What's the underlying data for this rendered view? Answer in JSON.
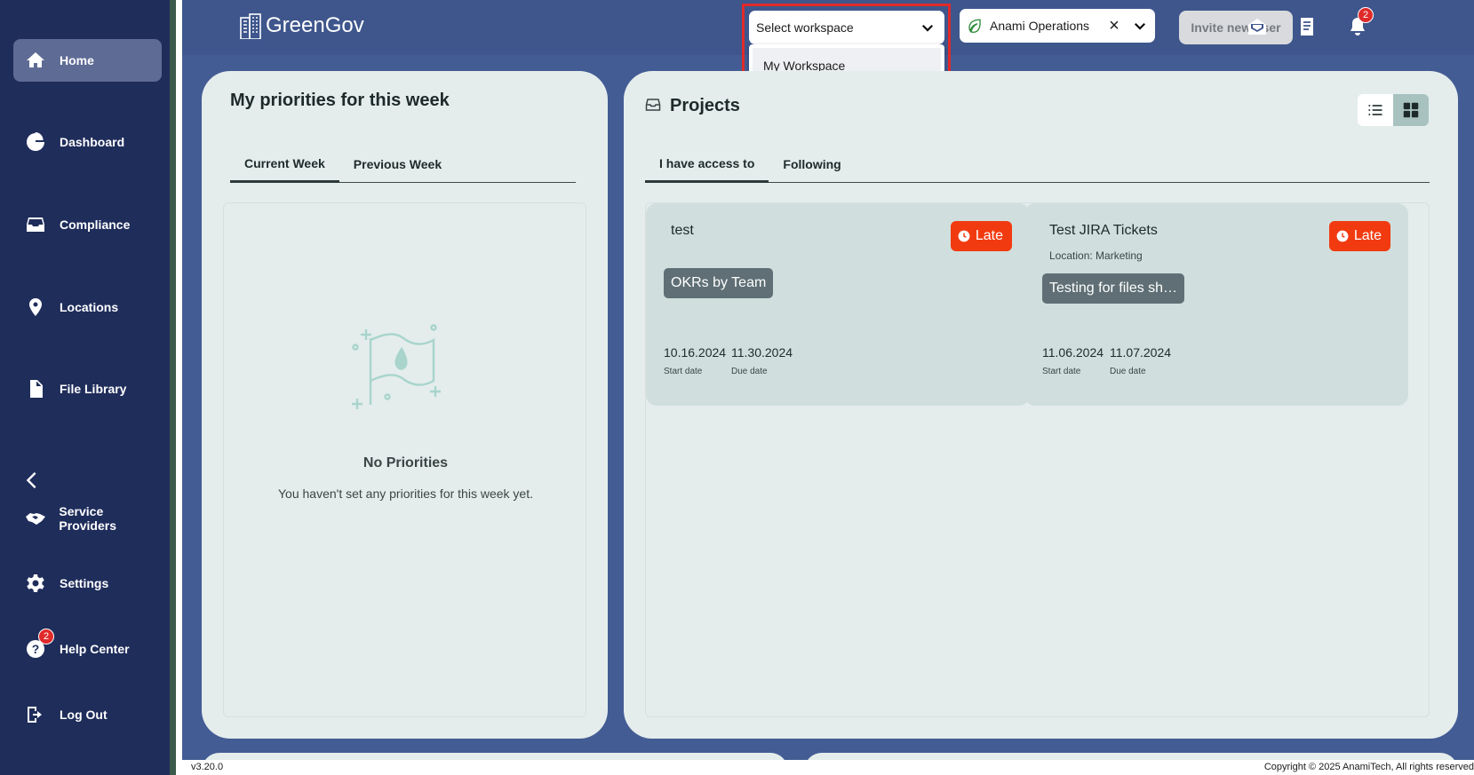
{
  "app": {
    "name": "GreenGov",
    "version": "v3.20.0",
    "copyright": "Copyright © 2025 AnamiTech, All rights reserved"
  },
  "sidebar": {
    "items": [
      {
        "label": "Home",
        "icon": "home-icon",
        "active": true
      },
      {
        "label": "Dashboard",
        "icon": "pie-chart-icon"
      },
      {
        "label": "Compliance",
        "icon": "inbox-icon"
      },
      {
        "label": "Locations",
        "icon": "location-pin-icon"
      },
      {
        "label": "File Library",
        "icon": "file-icon"
      },
      {
        "label": "Service Providers",
        "icon": "handshake-icon"
      },
      {
        "label": "Settings",
        "icon": "gear-icon"
      },
      {
        "label": "Help Center",
        "icon": "help-icon",
        "badge": "2"
      },
      {
        "label": "Log Out",
        "icon": "logout-icon"
      }
    ]
  },
  "header": {
    "workspace_select": {
      "placeholder": "Select workspace",
      "options": [
        "My Workspace"
      ]
    },
    "org_select": {
      "value": "Anami Operations",
      "clear": "×"
    },
    "invite_label": "Invite new user",
    "notification_count": "2"
  },
  "priorities": {
    "title": "My priorities for this week",
    "tabs": [
      "Current Week",
      "Previous Week"
    ],
    "empty_title": "No Priorities",
    "empty_text": "You haven't set any priorities for this week yet."
  },
  "projects": {
    "title": "Projects",
    "tabs": [
      "I have access to",
      "Following"
    ],
    "items": [
      {
        "name": "test",
        "location": "",
        "status": "Late",
        "tag": "OKRs by Team",
        "start_date": "10.16.2024",
        "due_date": "11.30.2024",
        "start_label": "Start date",
        "due_label": "Due date"
      },
      {
        "name": "Test JIRA Tickets",
        "location": "Location: Marketing",
        "status": "Late",
        "tag": "Testing for files sh…",
        "start_date": "11.06.2024",
        "due_date": "11.07.2024",
        "start_label": "Start date",
        "due_label": "Due date"
      }
    ]
  },
  "colors": {
    "sidebar": "#1f2d5b",
    "main": "#445c94",
    "card": "#e4edec",
    "late": "#f23a10",
    "highlight": "#e02a2a"
  }
}
